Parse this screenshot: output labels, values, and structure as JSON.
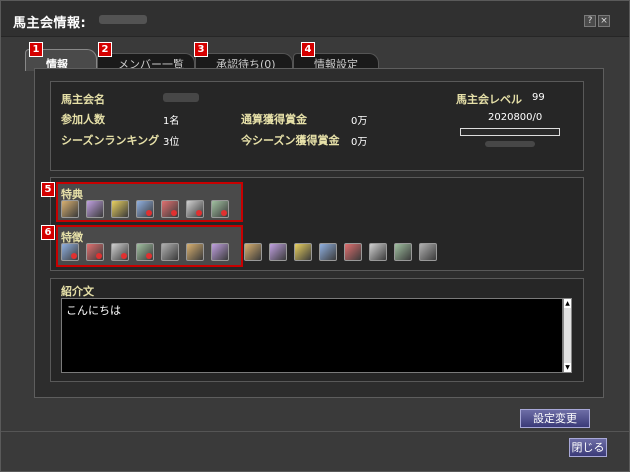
{
  "window": {
    "title": "馬主会情報:",
    "help_label": "?",
    "close_label": "×"
  },
  "tabs": [
    {
      "label": "情報",
      "num": "1"
    },
    {
      "label": "メンバー一覧",
      "num": "2"
    },
    {
      "label": "承認待ち(0)",
      "num": "3"
    },
    {
      "label": "情報設定",
      "num": "4"
    }
  ],
  "info": {
    "name_label": "馬主会名",
    "members_label": "参加人数",
    "members_value": "1名",
    "total_prize_label": "通算獲得賞金",
    "total_prize_value": "0万",
    "season_rank_label": "シーズンランキング",
    "season_rank_value": "3位",
    "season_prize_label": "今シーズン獲得賞金",
    "season_prize_value": "0万",
    "level_label": "馬主会レベル",
    "level_value": "99",
    "exp_value": "2020800/0",
    "exp_fraction": 0
  },
  "benefits": {
    "num": "5",
    "label": "特典",
    "icons": [
      "buy-icon",
      "sell-icon",
      "coin-icon",
      "train-icon",
      "breed-icon",
      "clinic-icon",
      "race-icon"
    ]
  },
  "features": {
    "num": "6",
    "label": "特徴",
    "icons": [
      "jockey-icon",
      "flag-icon",
      "trainer-icon",
      "doctor-icon",
      "free-icon",
      "free-icon",
      "cup-icon"
    ],
    "extra_icons": [
      "pair-icon",
      "brush-icon",
      "gift-icon",
      "rider-icon",
      "calendar-icon",
      "free-star-icon",
      "exp-icon",
      "g1-icon"
    ]
  },
  "intro": {
    "label": "紹介文",
    "text": "こんにちは"
  },
  "buttons": {
    "settings_change": "設定変更",
    "close": "閉じる"
  },
  "icon_glyphs": {
    "free_text": "FREE",
    "g1_text": "GI",
    "exp_text": "EX"
  },
  "colors": {
    "label_yellow": "#e6e0a8",
    "highlight_red": "#c80000",
    "button_blue": "#4a4a8a"
  }
}
